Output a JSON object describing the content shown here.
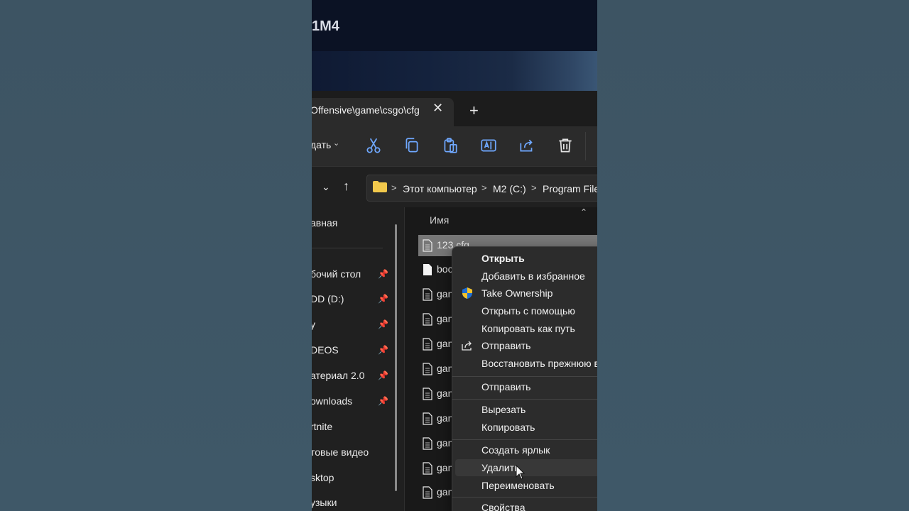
{
  "backdrop_title": "1M4",
  "tab": {
    "label": "Offensive\\game\\csgo\\cfg",
    "close_glyph": "✕",
    "new_glyph": "+"
  },
  "toolbar": {
    "create_label": "дать",
    "create_caret": "⌄",
    "icons": [
      "cut-icon",
      "copy-icon",
      "paste-icon",
      "rename-icon",
      "share-icon",
      "delete-icon"
    ]
  },
  "navigation": {
    "expand_glyph": "⌄",
    "up_glyph": "↑"
  },
  "address": {
    "separator": ">",
    "crumbs": [
      "Этот компьютер",
      "M2 (C:)",
      "Program Files"
    ]
  },
  "sidebar": {
    "items": [
      {
        "label": "авная",
        "pinned": false
      },
      {
        "label": "бочий стол",
        "pinned": true
      },
      {
        "label": "DD (D:)",
        "pinned": true
      },
      {
        "label": "y",
        "pinned": true
      },
      {
        "label": "DEOS",
        "pinned": true
      },
      {
        "label": "атериал 2.0",
        "pinned": true
      },
      {
        "label": "ownloads",
        "pinned": true
      },
      {
        "label": "rtnite",
        "pinned": false
      },
      {
        "label": "товые видео",
        "pinned": false
      },
      {
        "label": "sktop",
        "pinned": false
      },
      {
        "label": "узыки",
        "pinned": false
      }
    ],
    "pin_glyph": "📌"
  },
  "files": {
    "column_name": "Имя",
    "sort_glyph": "⌃",
    "rows": [
      "123.cfg",
      "boc",
      "gan",
      "gan",
      "gan",
      "gan",
      "gan",
      "gan",
      "gan",
      "gan",
      "gan"
    ]
  },
  "context_menu": {
    "items": [
      {
        "label": "Открыть",
        "bold": true,
        "icon": ""
      },
      {
        "label": "Добавить в избранное",
        "bold": false,
        "icon": ""
      },
      {
        "label": "Take Ownership",
        "bold": false,
        "icon": "shield-icon"
      },
      {
        "label": "Открыть с помощью",
        "bold": false,
        "icon": ""
      },
      {
        "label": "Копировать как путь",
        "bold": false,
        "icon": ""
      },
      {
        "label": "Отправить",
        "bold": false,
        "icon": "share-icon"
      },
      {
        "label": "Восстановить прежнюю ве",
        "bold": false,
        "icon": ""
      },
      {
        "label": "Отправить",
        "bold": false,
        "icon": ""
      },
      {
        "label": "Вырезать",
        "bold": false,
        "icon": ""
      },
      {
        "label": "Копировать",
        "bold": false,
        "icon": ""
      },
      {
        "label": "Создать ярлык",
        "bold": false,
        "icon": ""
      },
      {
        "label": "Удалить",
        "bold": false,
        "icon": ""
      },
      {
        "label": "Переименовать",
        "bold": false,
        "icon": ""
      },
      {
        "label": "Свойства",
        "bold": false,
        "icon": ""
      }
    ]
  },
  "colors": {
    "accent_shield_blue": "#1f6fd6",
    "accent_shield_yellow": "#f3c22b",
    "folder_yellow": "#f2c94c"
  }
}
